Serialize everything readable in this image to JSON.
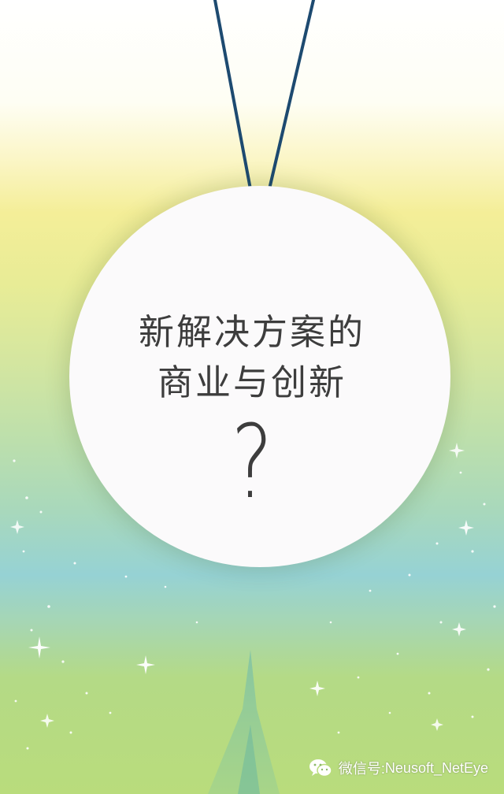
{
  "title": {
    "line1": "新解决方案的",
    "line2": "商业与创新",
    "mark": "?"
  },
  "watermark": {
    "label": "微信号:",
    "account": "Neusoft_NetEye",
    "icon": "wechat-icon"
  },
  "colors": {
    "string": "#1d4a70",
    "disc": "#fbfafb",
    "text": "#3d3d3d",
    "spike": "#8ec9a4"
  }
}
